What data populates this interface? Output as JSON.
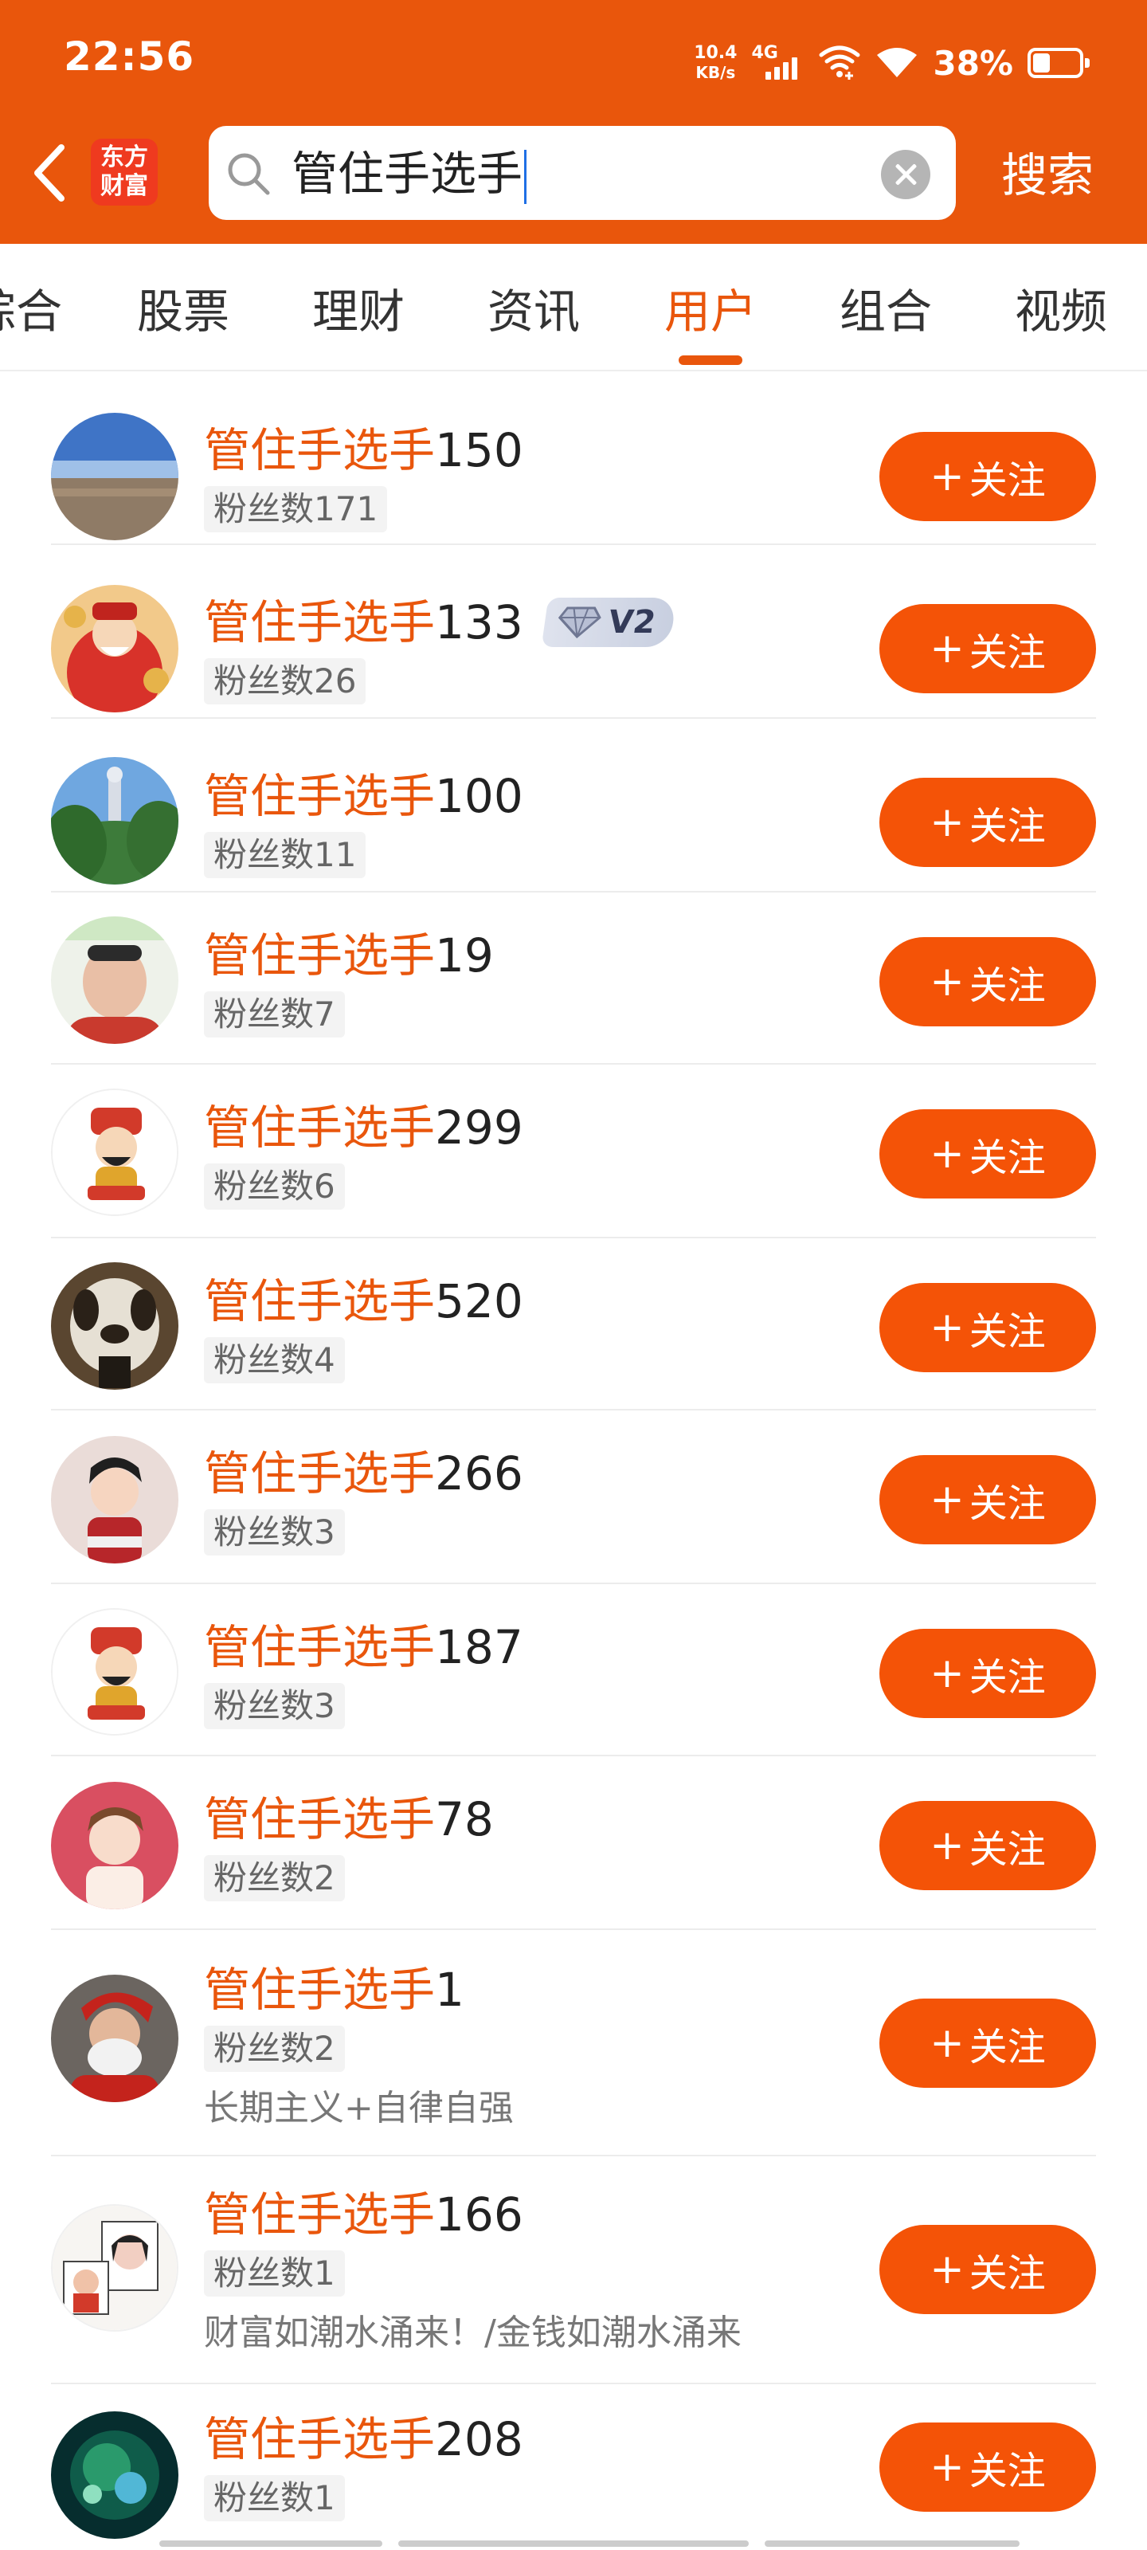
{
  "status_bar": {
    "time": "22:56",
    "net_speed_value": "10.4",
    "net_speed_unit": "KB/s",
    "network_type": "4G",
    "battery": "38%",
    "battery_level": 0.38
  },
  "header": {
    "logo_line1": "东方",
    "logo_line2": "财富",
    "search_query": "管住手选手",
    "search_button": "搜索"
  },
  "tabs": [
    "综合",
    "股票",
    "理财",
    "资讯",
    "用户",
    "组合",
    "视频"
  ],
  "active_tab": "用户",
  "users": [
    {
      "highlight": "管住手选手",
      "suffix": "150",
      "fans": "粉丝数171",
      "bio": ""
    },
    {
      "highlight": "管住手选手",
      "suffix": "133",
      "fans": "粉丝数26",
      "bio": "",
      "badge": "V2"
    },
    {
      "highlight": "管住手选手",
      "suffix": "100",
      "fans": "粉丝数11",
      "bio": ""
    },
    {
      "highlight": "管住手选手",
      "suffix": "19",
      "fans": "粉丝数7",
      "bio": ""
    },
    {
      "highlight": "管住手选手",
      "suffix": "299",
      "fans": "粉丝数6",
      "bio": ""
    },
    {
      "highlight": "管住手选手",
      "suffix": "520",
      "fans": "粉丝数4",
      "bio": ""
    },
    {
      "highlight": "管住手选手",
      "suffix": "266",
      "fans": "粉丝数3",
      "bio": ""
    },
    {
      "highlight": "管住手选手",
      "suffix": "187",
      "fans": "粉丝数3",
      "bio": ""
    },
    {
      "highlight": "管住手选手",
      "suffix": "78",
      "fans": "粉丝数2",
      "bio": ""
    },
    {
      "highlight": "管住手选手",
      "suffix": "1",
      "fans": "粉丝数2",
      "bio": "长期主义+自律自强"
    },
    {
      "highlight": "管住手选手",
      "suffix": "166",
      "fans": "粉丝数1",
      "bio": "财富如潮水涌来！/金钱如潮水涌来"
    },
    {
      "highlight": "管住手选手",
      "suffix": "208",
      "fans": "粉丝数1",
      "bio": ""
    }
  ],
  "follow_label": "关注",
  "follow_plus": "+",
  "colors": {
    "brand": "#e9560c",
    "follow_button": "#f45307"
  }
}
